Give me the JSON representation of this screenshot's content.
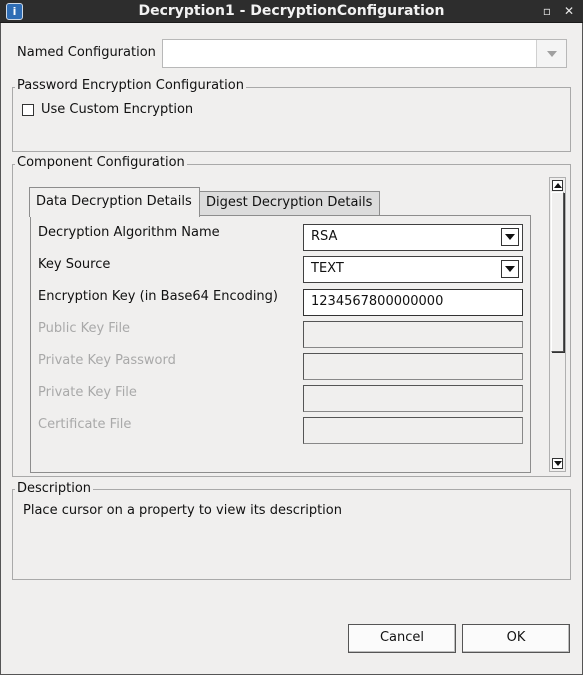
{
  "window": {
    "title": "Decryption1 - DecryptionConfiguration",
    "app_icon_glyph": "i",
    "minimize_glyph": "▫",
    "close_glyph": "✕"
  },
  "named_configuration": {
    "label": "Named Configuration",
    "value": ""
  },
  "password_encryption": {
    "title": "Password Encryption Configuration",
    "use_custom_label": "Use Custom Encryption",
    "use_custom_checked": false
  },
  "component_configuration": {
    "title": "Component Configuration",
    "tabs": [
      {
        "label": "Data Decryption Details",
        "active": true
      },
      {
        "label": "Digest Decryption Details",
        "active": false
      }
    ],
    "properties": {
      "algorithm": {
        "label": "Decryption Algorithm Name",
        "value": "RSA"
      },
      "key_source": {
        "label": "Key Source",
        "value": "TEXT"
      },
      "encryption_key": {
        "label": "Encryption Key (in Base64 Encoding)",
        "value": "1234567800000000"
      },
      "public_key_file": {
        "label": "Public Key File",
        "value": ""
      },
      "private_key_password": {
        "label": "Private Key Password",
        "value": ""
      },
      "private_key_file": {
        "label": "Private Key File",
        "value": ""
      },
      "certificate_file": {
        "label": "Certificate File",
        "value": ""
      }
    }
  },
  "description": {
    "title": "Description",
    "text": "Place cursor on a property to view its description"
  },
  "buttons": {
    "cancel": "Cancel",
    "ok": "OK"
  }
}
